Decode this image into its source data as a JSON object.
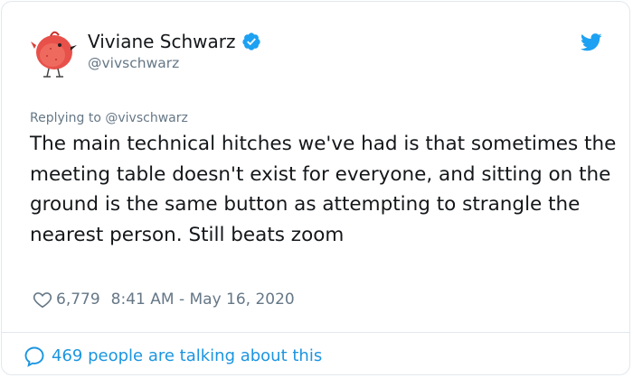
{
  "author": {
    "display_name": "Viviane Schwarz",
    "handle": "@vivschwarz",
    "verified": true
  },
  "reply_context": "Replying to @vivschwarz",
  "tweet_text": "The main technical hitches we've had is that sometimes the meeting table doesn't exist for everyone, and sitting on the ground is the same button as attempting to strangle the nearest person. Still beats zoom",
  "likes": "6,779",
  "timestamp": "8:41 AM - May 16, 2020",
  "engagement_text": "469 people are talking about this",
  "colors": {
    "brand_blue": "#1da1f2",
    "link_blue": "#1b95e0",
    "text_primary": "#14171a",
    "text_secondary": "#657786",
    "avatar_bird": "#e8504a"
  },
  "icons": {
    "avatar": "red-bird-avatar",
    "verified": "verified-badge-icon",
    "brand": "twitter-bird-icon",
    "like": "heart-icon",
    "engagement": "speech-bubble-icon"
  }
}
